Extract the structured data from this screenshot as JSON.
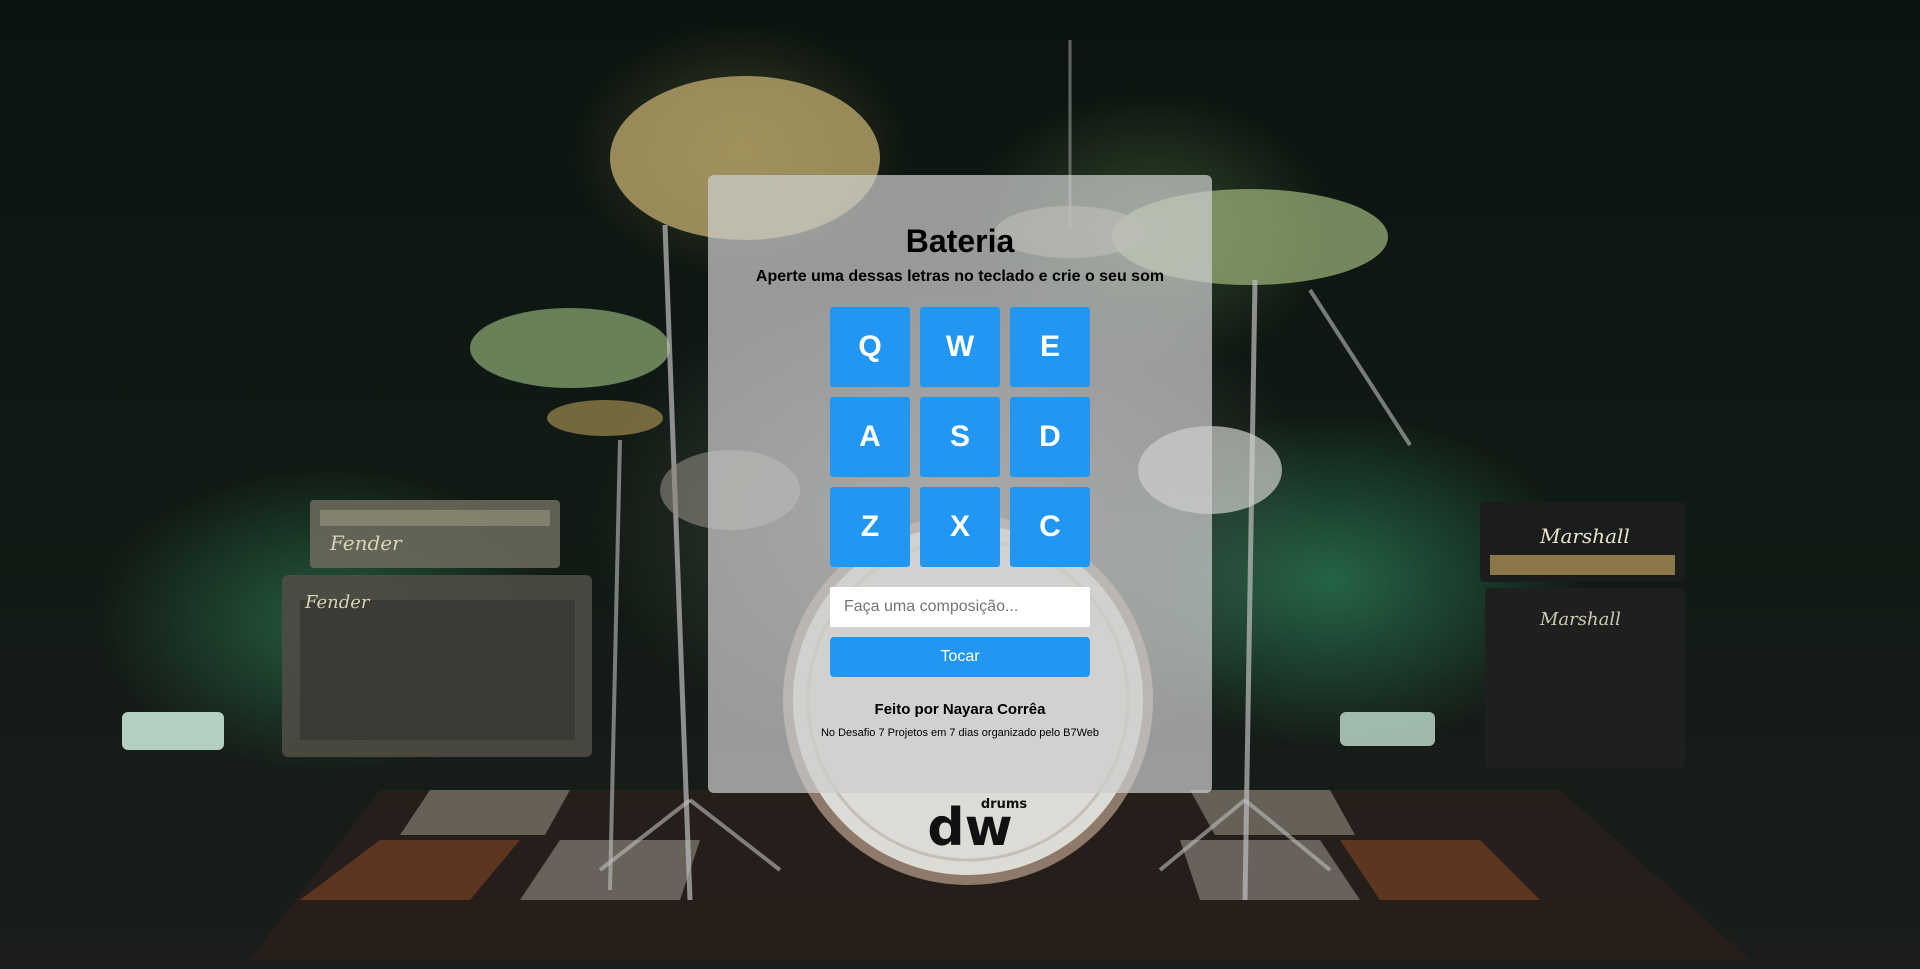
{
  "page": {
    "title": "Bateria",
    "subtitle": "Aperte uma dessas letras no teclado e crie o seu som"
  },
  "keys": [
    "Q",
    "W",
    "E",
    "A",
    "S",
    "D",
    "Z",
    "X",
    "C"
  ],
  "composer": {
    "placeholder": "Faça uma composição...",
    "value": "",
    "button_label": "Tocar"
  },
  "footer": {
    "credit": "Feito por Nayara Corrêa",
    "note": "No Desafio 7 Projetos em 7 dias organizado pelo B7Web"
  },
  "background": {
    "image": "drum-kit-stage-photo",
    "drum_logo": "dw",
    "drum_logo_sub": "drums",
    "amp_left": "Fender",
    "amp_right": "Marshall"
  },
  "colors": {
    "key": "#2196f3",
    "key_text": "#ffffff",
    "panel": "rgba(205,205,205,0.72)"
  }
}
